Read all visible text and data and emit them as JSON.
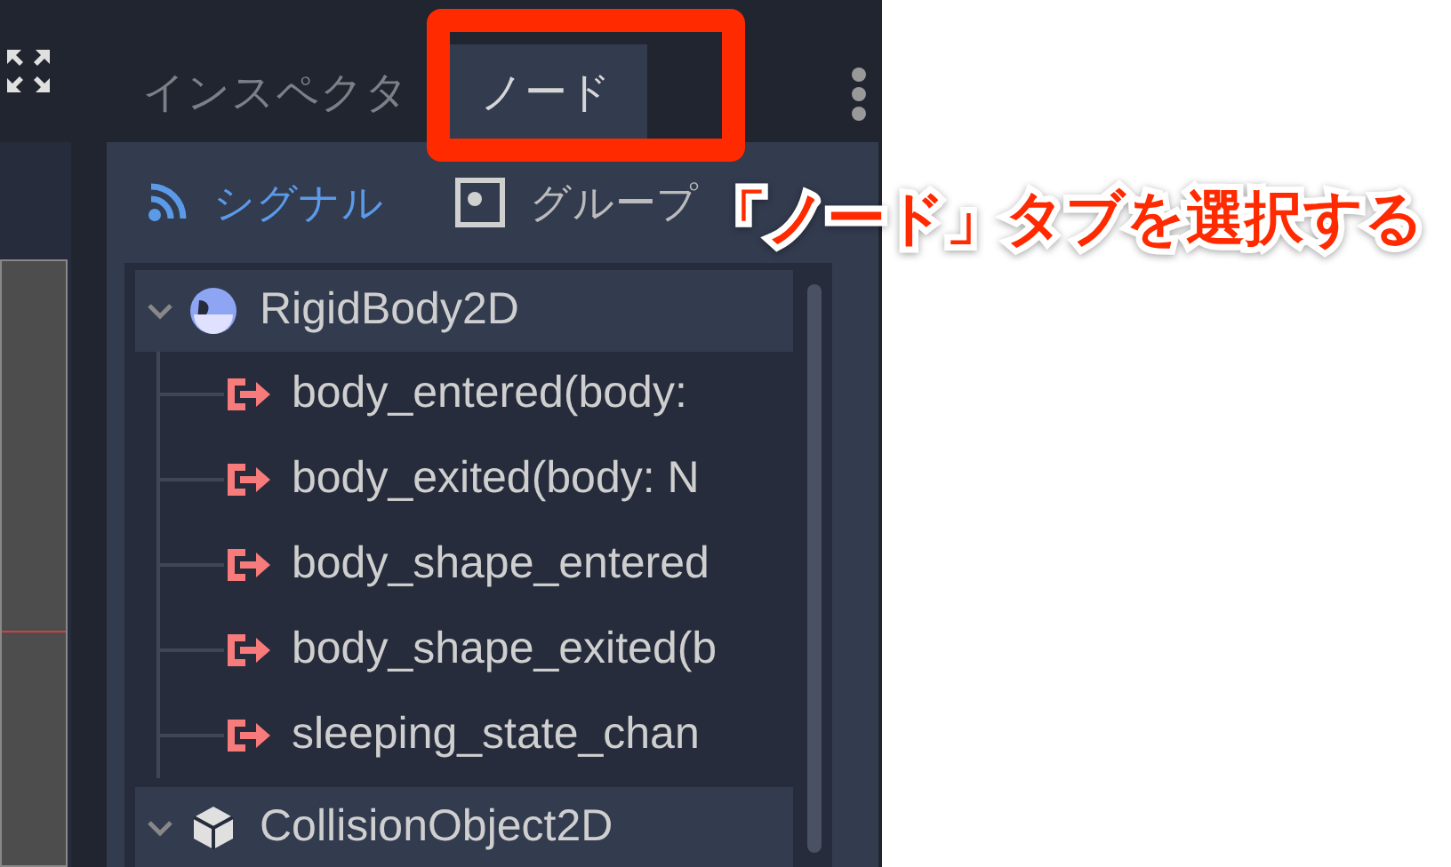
{
  "dock": {
    "tabs": [
      {
        "label": "インスペクタ",
        "selected": false
      },
      {
        "label": "ノード",
        "selected": true
      }
    ],
    "subtabs": [
      {
        "label": "シグナル",
        "selected": true,
        "kind": "signal"
      },
      {
        "label": "グループ",
        "selected": false,
        "kind": "group"
      }
    ],
    "tree": [
      {
        "label": "RigidBody2D",
        "kind": "rigid",
        "expanded": true,
        "children": [
          {
            "label": "body_entered(body:"
          },
          {
            "label": "body_exited(body: N"
          },
          {
            "label": "body_shape_entered"
          },
          {
            "label": "body_shape_exited(b"
          },
          {
            "label": "sleeping_state_chan"
          }
        ]
      },
      {
        "label": "CollisionObject2D",
        "kind": "collision",
        "expanded": true
      }
    ]
  },
  "annotation": {
    "text": "「ノード」タブを選択する"
  }
}
